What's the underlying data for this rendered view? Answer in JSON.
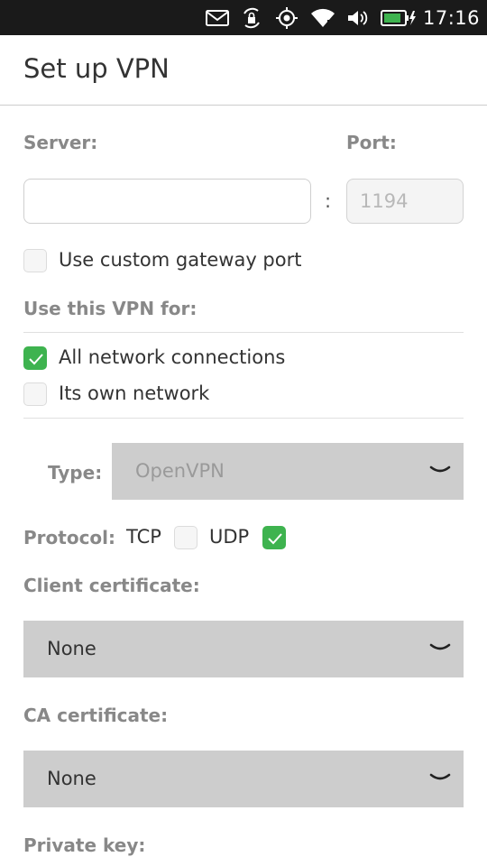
{
  "status_bar": {
    "time": "17:16",
    "icons": [
      "mail-icon",
      "rotation-lock-icon",
      "location-icon",
      "wifi-icon",
      "volume-icon",
      "battery-charging-icon"
    ]
  },
  "header": {
    "title": "Set up VPN"
  },
  "server": {
    "label": "Server:",
    "value": "",
    "placeholder": ""
  },
  "port": {
    "label": "Port:",
    "separator": ":",
    "placeholder": "1194"
  },
  "custom_gateway": {
    "label": "Use custom gateway port",
    "checked": false
  },
  "use_vpn_for": {
    "label": "Use this VPN for:",
    "options": [
      {
        "label": "All network connections",
        "checked": true
      },
      {
        "label": "Its own network",
        "checked": false
      }
    ]
  },
  "type": {
    "label": "Type:",
    "value": "OpenVPN"
  },
  "protocol": {
    "label": "Protocol:",
    "tcp": {
      "label": "TCP",
      "checked": false
    },
    "udp": {
      "label": "UDP",
      "checked": true
    }
  },
  "client_certificate": {
    "label": "Client certificate:",
    "value": "None"
  },
  "ca_certificate": {
    "label": "CA certificate:",
    "value": "None"
  },
  "private_key": {
    "label": "Private key:"
  },
  "colors": {
    "accent_green": "#3eb34f",
    "dropdown_bg": "#cdcdcd",
    "label_gray": "#888888"
  }
}
